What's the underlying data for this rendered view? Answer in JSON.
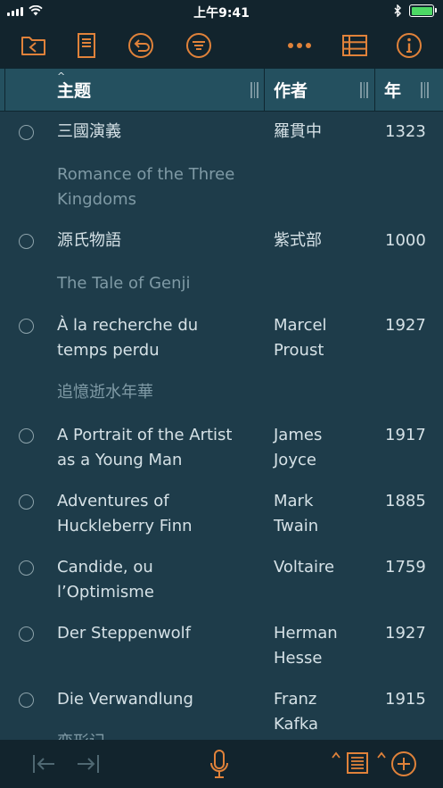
{
  "status_bar": {
    "time": "上午9:41"
  },
  "toolbar": {
    "icons": [
      "folder-back-icon",
      "document-icon",
      "undo-icon",
      "filter-icon",
      "more-icon",
      "grid-view-icon",
      "info-icon"
    ]
  },
  "table": {
    "columns": [
      {
        "label": "主题",
        "sorted": true
      },
      {
        "label": "作者"
      },
      {
        "label": "年"
      }
    ],
    "rows": [
      {
        "title": "三國演義",
        "author": "羅貫中",
        "year": "1323",
        "subtitle": "Romance of the Three\nKingdoms"
      },
      {
        "title": "源氏物語",
        "author": "紫式部",
        "year": "1000",
        "subtitle": "The Tale of Genji"
      },
      {
        "title": "À la recherche du\ntemps perdu",
        "author": "Marcel\nProust",
        "year": "1927",
        "subtitle": "追憶逝水年華"
      },
      {
        "title": "A Portrait of the Artist\nas a Young Man",
        "author": "James\nJoyce",
        "year": "1917"
      },
      {
        "title": "Adventures of\nHuckleberry Finn",
        "author": "Mark\nTwain",
        "year": "1885"
      },
      {
        "title": "Candide, ou\nl’Optimisme",
        "author": "Voltaire",
        "year": "1759"
      },
      {
        "title": "Der Steppenwolf",
        "author": "Herman\nHesse",
        "year": "1927"
      },
      {
        "title": "Die Verwandlung",
        "author": "Franz\nKafka",
        "year": "1915",
        "subtitle": "变形记"
      }
    ]
  },
  "colors": {
    "background": "#1e3c4a",
    "header_background": "#24505f",
    "bar_background": "#12242d",
    "accent": "#e0823a",
    "text": "#d5e1e6",
    "subtitle_text": "#7f9aa5",
    "disabled_icon": "#4f6872"
  }
}
